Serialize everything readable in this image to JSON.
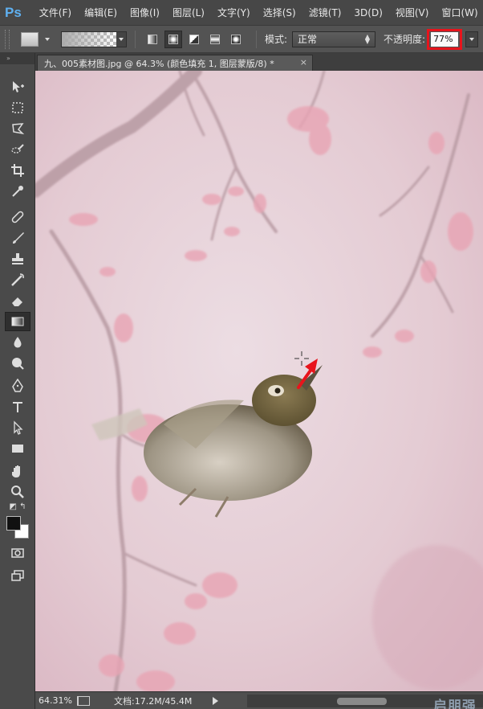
{
  "app": {
    "logo": "Ps"
  },
  "menu": [
    "文件(F)",
    "编辑(E)",
    "图像(I)",
    "图层(L)",
    "文字(Y)",
    "选择(S)",
    "滤镜(T)",
    "3D(D)",
    "视图(V)",
    "窗口(W)"
  ],
  "options": {
    "mode_label": "模式:",
    "mode_value": "正常",
    "opacity_label": "不透明度:",
    "opacity_value": "77%"
  },
  "document": {
    "tab_title": "九、005素材图.jpg @ 64.3% (颜色填充 1, 图层蒙版/8) *",
    "close_glyph": "×"
  },
  "status": {
    "zoom": "64.31%",
    "doc_info": "文档:17.2M/45.4M"
  },
  "watermark": "启朋强",
  "colors": {
    "accent_red": "#e8141c",
    "canvas_pink": "#e6cdd5",
    "foreground": "#111111",
    "background": "#ffffff"
  },
  "toolbox": {
    "icons": [
      "move-tool-icon",
      "marquee-tool-icon",
      "lasso-tool-icon",
      "quick-select-tool-icon",
      "crop-tool-icon",
      "eyedropper-tool-icon",
      "healing-brush-tool-icon",
      "brush-tool-icon",
      "clone-stamp-tool-icon",
      "history-brush-tool-icon",
      "eraser-tool-icon",
      "gradient-tool-icon",
      "blur-tool-icon",
      "dodge-tool-icon",
      "pen-tool-icon",
      "type-tool-icon",
      "path-select-tool-icon",
      "shape-tool-icon",
      "hand-tool-icon",
      "zoom-tool-icon"
    ]
  }
}
